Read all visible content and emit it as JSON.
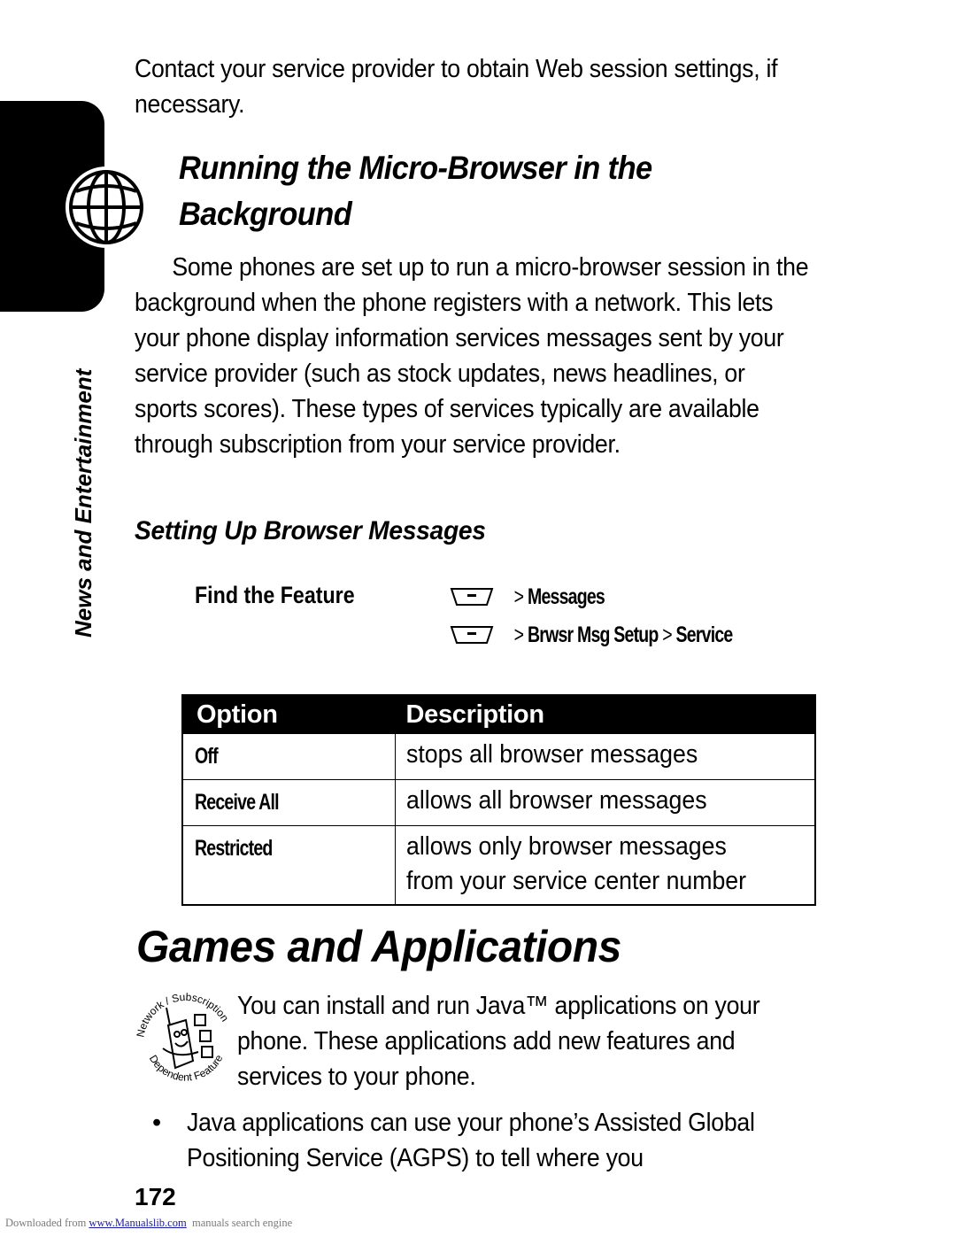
{
  "page": {
    "intro": "Contact your service provider to obtain Web session settings, if necessary.",
    "section_tab": {
      "icon": "globe-icon",
      "side_label_bold": "News",
      "side_label_mid": " and ",
      "side_label_end": "Entertainment"
    },
    "section_heading": "Running the Micro-Browser in the Background",
    "paragraph_1": "Some phones are set up to run a micro-browser session in the background when the phone registers with a network. This lets your phone display information services messages sent by your service provider (such as stock updates, news headlines, or sports scores). These types of services typically are available through subscription from your service provider.",
    "subheading": "Setting Up Browser Messages",
    "find_feature": {
      "label": "Find the Feature",
      "paths": [
        {
          "key_icon": "menu-softkey-icon",
          "steps": [
            "Messages"
          ]
        },
        {
          "key_icon": "menu-softkey-icon",
          "steps": [
            "Brwsr Msg Setup",
            "Service"
          ]
        }
      ],
      "separator": ">"
    },
    "options_table": {
      "headers": [
        "Option",
        "Description"
      ],
      "rows": [
        {
          "option": "Off",
          "description": [
            "stops all browser messages"
          ]
        },
        {
          "option": "Receive All",
          "description": [
            "allows all browser messages"
          ]
        },
        {
          "option": "Restricted",
          "description": [
            "allows only browser messages",
            "from your service center number"
          ]
        }
      ]
    },
    "main_heading": "Games and Applications",
    "feature_badge": {
      "icon": "network-subscription-dependent-feature-icon",
      "text_top": "Network / Subscription",
      "text_bottom": "Dependent Feature"
    },
    "paragraph_2": "You can install and run Java™ applications on your phone. These applications add new features and services to your phone.",
    "bullets": [
      "Java applications can use your phone’s Assisted Global Positioning Service (AGPS) to tell where you"
    ],
    "page_number": "172"
  },
  "footer": {
    "prefix": "Downloaded from ",
    "link_text": "www.Manualslib.com",
    "suffix": "  manuals search engine"
  }
}
